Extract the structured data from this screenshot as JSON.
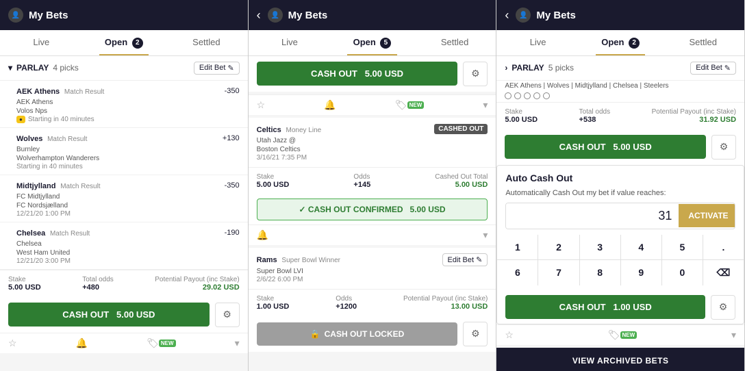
{
  "panels": [
    {
      "id": "panel1",
      "header": {
        "back": "‹",
        "title": "My Bets",
        "showBack": false
      },
      "tabs": [
        {
          "label": "Live",
          "active": false,
          "badge": null
        },
        {
          "label": "Open",
          "active": true,
          "badge": "2"
        },
        {
          "label": "Settled",
          "active": false,
          "badge": null
        }
      ],
      "section": {
        "type": "parlay",
        "label": "PARLAY",
        "picks": "4 picks",
        "editBet": "Edit Bet",
        "matches": [
          {
            "name": "AEK Athens",
            "type": "Match Result",
            "odds": "-350",
            "team1": "AEK Athens",
            "team2": "Volos Nps",
            "time": "Starting in 40 minutes",
            "showLive": true
          },
          {
            "name": "Wolves",
            "type": "Match Result",
            "odds": "+130",
            "team1": "Burnley",
            "team2": "Wolverhampton Wanderers",
            "time": "Starting in 40 minutes",
            "showLive": false
          },
          {
            "name": "Midtjylland",
            "type": "Match Result",
            "odds": "-350",
            "team1": "FC Midtjylland",
            "team2": "FC Nordsjælland",
            "time": "12/21/20 1:00 PM",
            "showLive": false
          },
          {
            "name": "Chelsea",
            "type": "Match Result",
            "odds": "-190",
            "team1": "Chelsea",
            "team2": "West Ham United",
            "time": "12/21/20 3:00 PM",
            "showLive": false
          }
        ],
        "stake": {
          "stakeLabel": "Stake",
          "stakeValue": "5.00 USD",
          "oddsLabel": "Total odds",
          "oddsValue": "+480",
          "payoutLabel": "Potential Payout (inc Stake)",
          "payoutValue": "29.02 USD"
        },
        "cashoutBtn": "CASH OUT",
        "cashoutAmount": "5.00 USD",
        "actions": [
          "star",
          "bell",
          "new-promo"
        ]
      }
    },
    {
      "id": "panel2",
      "header": {
        "back": "‹",
        "title": "My Bets",
        "showBack": true
      },
      "tabs": [
        {
          "label": "Live",
          "active": false,
          "badge": null
        },
        {
          "label": "Open",
          "active": true,
          "badge": "5"
        },
        {
          "label": "Settled",
          "active": false,
          "badge": null
        }
      ],
      "topCashout": {
        "btn": "CASH OUT",
        "amount": "5.00 USD"
      },
      "bets": [
        {
          "id": "celtics",
          "name": "Celtics",
          "type": "Money Line",
          "cashedOut": true,
          "cashedOutLabel": "CASHED OUT",
          "team1": "Utah Jazz @",
          "team2": "Boston Celtics",
          "date": "3/16/21 7:35 PM",
          "stakeLabel": "Stake",
          "stakeValue": "5.00 USD",
          "oddsLabel": "Odds",
          "oddsValue": "+145",
          "payoutLabel": "Cashed Out Total",
          "payoutValue": "5.00 USD",
          "confirmed": true,
          "confirmedText": "✓ CASH OUT CONFIRMED",
          "confirmedAmount": "5.00 USD"
        },
        {
          "id": "rams",
          "name": "Rams",
          "type": "Super Bowl Winner",
          "editBet": "Edit Bet",
          "team1": "Super Bowl LVI",
          "date": "2/6/22 6:00 PM",
          "stakeLabel": "Stake",
          "stakeValue": "1.00 USD",
          "oddsLabel": "Odds",
          "oddsValue": "+1200",
          "payoutLabel": "Potential Payout (inc Stake)",
          "payoutValue": "13.00 USD",
          "locked": true,
          "lockedText": "CASH OUT LOCKED"
        }
      ]
    },
    {
      "id": "panel3",
      "header": {
        "back": "‹",
        "title": "My Bets",
        "showBack": true
      },
      "tabs": [
        {
          "label": "Live",
          "active": false,
          "badge": null
        },
        {
          "label": "Open",
          "active": true,
          "badge": "2"
        },
        {
          "label": "Settled",
          "active": false,
          "badge": null
        }
      ],
      "parlay": {
        "label": "PARLAY",
        "picks": "5 picks",
        "editBet": "Edit Bet",
        "teams": "AEK Athens | Wolves | Midtjylland | Chelsea | Steelers",
        "circles": 5,
        "stakeLabel": "Stake",
        "stakeValue": "5.00 USD",
        "oddsLabel": "Total odds",
        "oddsValue": "+538",
        "payoutLabel": "Potential Payout (inc Stake)",
        "payoutValue": "31.92 USD",
        "cashoutBtn": "CASH OUT",
        "cashoutAmount": "5.00 USD"
      },
      "autoCashOut": {
        "title": "Auto Cash Out",
        "description": "Automatically Cash Out my bet if value reaches:",
        "currentValue": "31",
        "activateLabel": "ACTIVATE",
        "numpad": [
          "1",
          "2",
          "3",
          "4",
          "5",
          ".",
          "6",
          "7",
          "8",
          "9",
          "0",
          "⌫"
        ],
        "cashoutLabel": "CASH OUT",
        "cashoutAmount": "1.00 USD"
      },
      "actions": [
        "star",
        "new-promo"
      ],
      "viewArchived": "VIEW ARCHIVED BETS"
    }
  ]
}
